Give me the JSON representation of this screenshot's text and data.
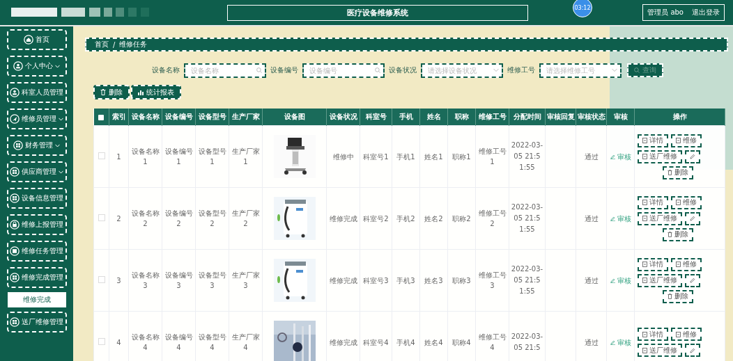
{
  "header": {
    "title": "医疗设备维修系统",
    "clock": "03:12",
    "user": "管理员 abo",
    "logout": "退出登录"
  },
  "sidebar": {
    "items": [
      {
        "label": "首页",
        "caret": false
      },
      {
        "label": "个人中心",
        "caret": true
      },
      {
        "label": "科室人员管理",
        "caret": false
      },
      {
        "label": "维修员管理",
        "caret": true
      },
      {
        "label": "财务管理",
        "caret": true
      },
      {
        "label": "供应商管理",
        "caret": true
      },
      {
        "label": "设备信息管理",
        "caret": false
      },
      {
        "label": "维修上报管理",
        "caret": false
      },
      {
        "label": "维修任务管理",
        "caret": false
      },
      {
        "label": "维修完成管理",
        "caret": false,
        "children": [
          {
            "label": "维修完成",
            "selected": true
          }
        ]
      },
      {
        "label": "送厂维修管理",
        "caret": false
      }
    ]
  },
  "breadcrumb": {
    "separator": "/",
    "items": [
      "首页",
      "维修任务"
    ]
  },
  "filters": [
    {
      "label": "设备名称",
      "kind": "search",
      "placeholder": "设备名称"
    },
    {
      "label": "设备编号",
      "kind": "search",
      "placeholder": "设备编号"
    },
    {
      "label": "设备状况",
      "kind": "select",
      "placeholder": "请选择设备状况"
    },
    {
      "label": "维修工号",
      "kind": "select",
      "placeholder": "请选择维修工号"
    }
  ],
  "query_button": "查询",
  "toolbar": [
    {
      "label": "删除",
      "kind": "delete"
    },
    {
      "label": "统计报表",
      "kind": "chart"
    }
  ],
  "table": {
    "select_all": {
      "checked": false
    },
    "columns": [
      "索引",
      "设备名称",
      "设备编号",
      "设备型号",
      "生产厂家",
      "设备图",
      "设备状况",
      "科室号",
      "手机",
      "姓名",
      "职称",
      "维修工号",
      "分配时间",
      "审核回复",
      "审核状态",
      "审核",
      "操作"
    ],
    "rows": [
      {
        "checked": false,
        "cells": [
          "1",
          "设备名称1",
          "设备编号1",
          "设备型号1",
          "生产厂家1"
        ],
        "image": {
          "kind": "picture"
        },
        "cells2": [
          "维修中",
          "科室号1",
          "手机1",
          "姓名1",
          "职称1",
          "维修工号1",
          "2022-03-05 21:51:55"
        ],
        "audit_status": "通过",
        "audit_link": "审核",
        "actions": [
          {
            "kind": "detail",
            "label": "详情"
          },
          {
            "kind": "repair",
            "label": "维修"
          },
          {
            "kind": "factory",
            "label": "送厂维修"
          },
          {
            "kind": "edit"
          },
          {
            "kind": "delete",
            "label": "删除"
          }
        ]
      },
      {
        "checked": false,
        "cells": [
          "2",
          "设备名称2",
          "设备编号2",
          "设备型号2",
          "生产厂家2"
        ],
        "image": {
          "kind": "picture"
        },
        "cells2": [
          "维修完成",
          "科室号2",
          "手机2",
          "姓名2",
          "职称2",
          "维修工号2",
          "2022-03-05 21:51:55"
        ],
        "audit_status": "通过",
        "audit_link": "审核",
        "actions": [
          {
            "kind": "detail",
            "label": "详情"
          },
          {
            "kind": "repair",
            "label": "维修"
          },
          {
            "kind": "factory",
            "label": "送厂维修"
          },
          {
            "kind": "edit"
          },
          {
            "kind": "delete",
            "label": "删除"
          }
        ]
      },
      {
        "checked": false,
        "cells": [
          "3",
          "设备名称3",
          "设备编号3",
          "设备型号3",
          "生产厂家3"
        ],
        "image": {
          "kind": "picture"
        },
        "cells2": [
          "维修完成",
          "科室号3",
          "手机3",
          "姓名3",
          "职称3",
          "维修工号3",
          "2022-03-05 21:51:55"
        ],
        "audit_status": "通过",
        "audit_link": "审核",
        "actions": [
          {
            "kind": "detail",
            "label": "详情"
          },
          {
            "kind": "repair",
            "label": "维修"
          },
          {
            "kind": "factory",
            "label": "送厂维修"
          },
          {
            "kind": "edit"
          },
          {
            "kind": "delete",
            "label": "删除"
          }
        ]
      },
      {
        "checked": false,
        "cells": [
          "4",
          "设备名称4",
          "设备编号4",
          "设备型号4",
          "生产厂家4"
        ],
        "image": {
          "kind": "picture"
        },
        "cells2": [
          "维修完成",
          "科室号4",
          "手机4",
          "姓名4",
          "职称4",
          "维修工号4",
          "2022-03-05 21:5"
        ],
        "audit_status": "通过",
        "audit_link": "审核",
        "actions": [
          {
            "kind": "detail",
            "label": "详情"
          },
          {
            "kind": "repair",
            "label": "维修"
          },
          {
            "kind": "factory",
            "label": "送厂维修"
          },
          {
            "kind": "edit"
          }
        ]
      }
    ]
  }
}
